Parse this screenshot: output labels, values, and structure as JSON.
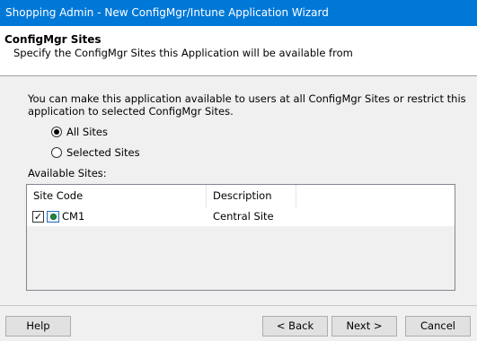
{
  "window": {
    "title": "Shopping Admin - New ConfigMgr/Intune Application Wizard"
  },
  "header": {
    "title": "ConfigMgr Sites",
    "subtitle": "Specify the ConfigMgr Sites this Application will be available from"
  },
  "body": {
    "description": "You can make this application available to users at all ConfigMgr Sites or restrict this application to selected ConfigMgr Sites.",
    "options": [
      {
        "label": "All Sites",
        "checked": true
      },
      {
        "label": "Selected Sites",
        "checked": false
      }
    ],
    "available_label": "Available Sites:"
  },
  "sites_table": {
    "columns": [
      "Site Code",
      "Description"
    ],
    "rows": [
      {
        "code": "CM1",
        "description": "Central Site",
        "checked": true,
        "icon": "site-server-icon"
      }
    ]
  },
  "footer": {
    "help": "Help",
    "back": "< Back",
    "next": "Next >",
    "cancel": "Cancel"
  }
}
